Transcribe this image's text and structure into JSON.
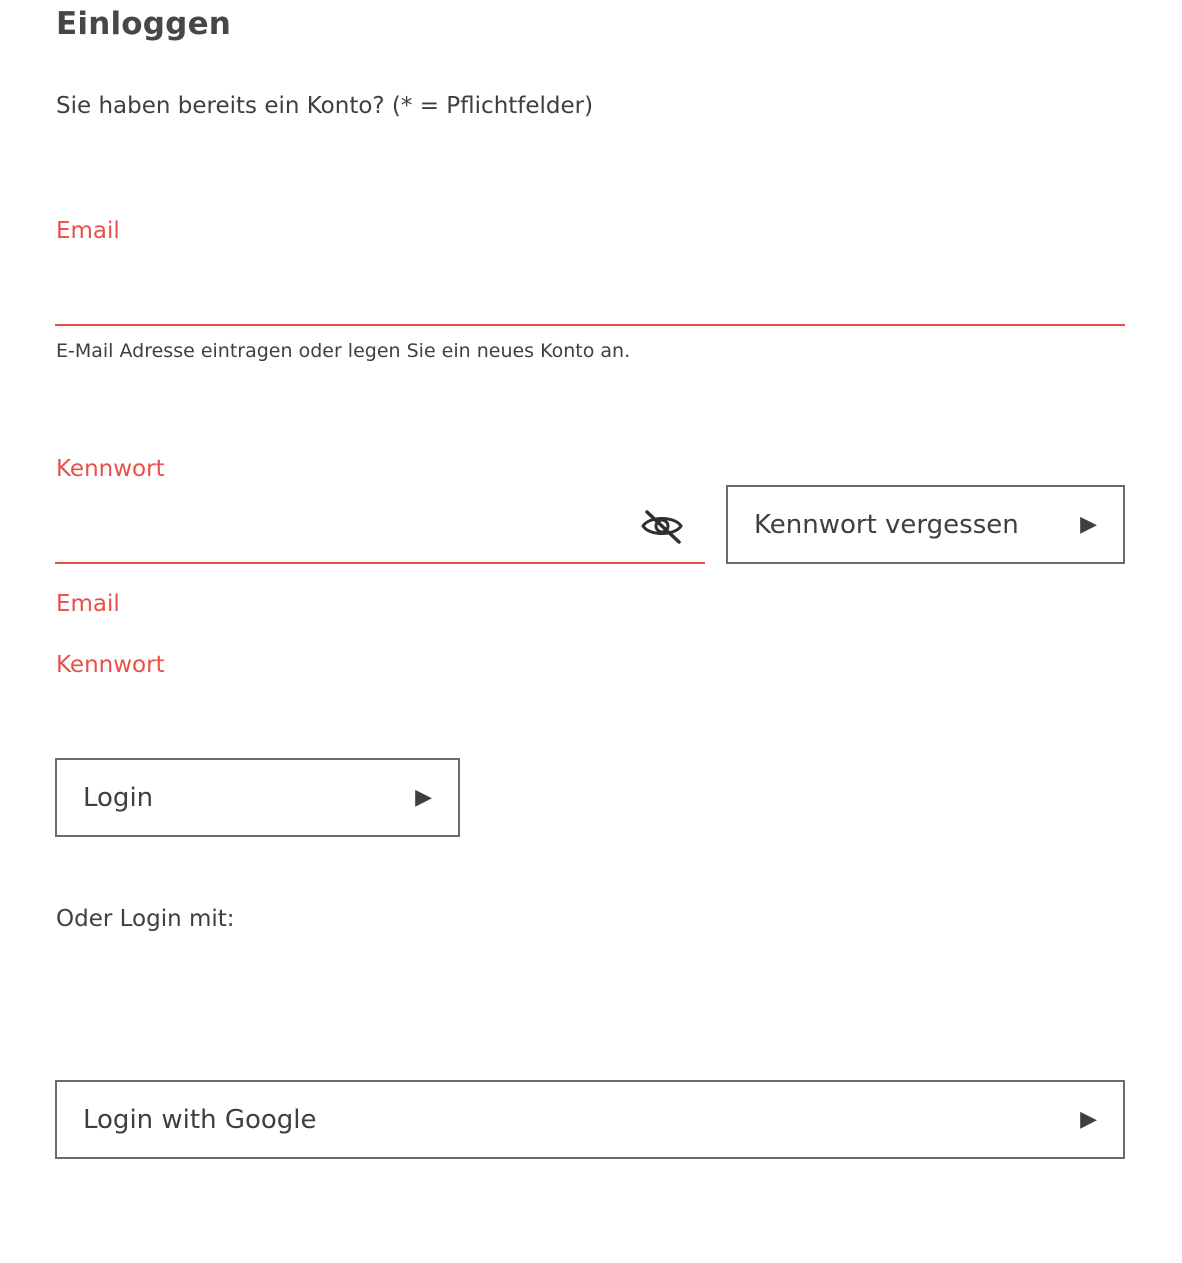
{
  "title": "Einloggen",
  "intro": "Sie haben bereits ein Konto? (* = Pflichtfelder)",
  "email": {
    "label": "Email",
    "value": "",
    "hint": "E-Mail Adresse eintragen oder legen Sie ein neues Konto an."
  },
  "password": {
    "label": "Kennwort",
    "value": "",
    "toggle_icon": "eye-slash-icon"
  },
  "forgot_button": {
    "label": "Kennwort vergessen",
    "arrow": "▶"
  },
  "errors": {
    "email": "Email",
    "password": "Kennwort"
  },
  "login_button": {
    "label": "Login",
    "arrow": "▶"
  },
  "or_text": "Oder Login mit:",
  "google_button": {
    "label": "Login with Google",
    "arrow": "▶"
  },
  "colors": {
    "accent": "#e8504a",
    "text": "#3f3f3f",
    "border": "#6a6a6a"
  }
}
